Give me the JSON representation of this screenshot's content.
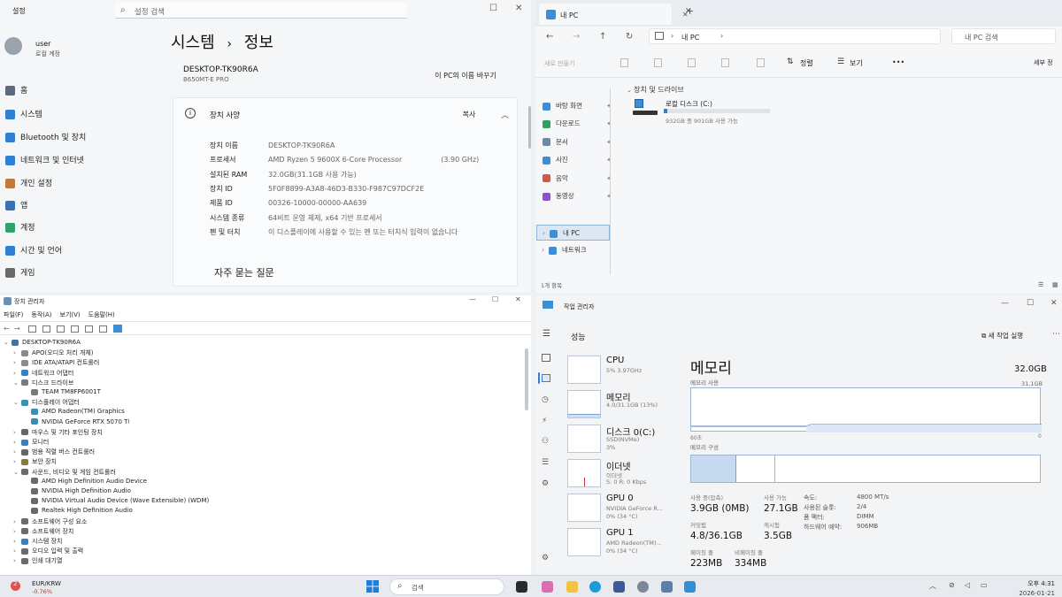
{
  "settings": {
    "app_title": "설정",
    "search_placeholder": "설정 검색",
    "user_name": "user",
    "user_sub": "로컬 계정",
    "breadcrumb_parent": "시스템",
    "breadcrumb_sep": "›",
    "breadcrumb_current": "정보",
    "device_name": "DESKTOP-TK90R6A",
    "device_model": "B650MT-E PRO",
    "rename_button": "이 PC의 이름 바꾸기",
    "specs_header": "장치 사양",
    "copy_button": "복사",
    "faq_label": "자주 묻는 질문",
    "nav": [
      {
        "label": "홈",
        "icon": "home-icon",
        "color": "#5a6b80"
      },
      {
        "label": "시스템",
        "icon": "monitor-icon",
        "color": "#2f7fd3"
      },
      {
        "label": "Bluetooth 및 장치",
        "icon": "bluetooth-icon",
        "color": "#2f7fd3"
      },
      {
        "label": "네트워크 및 인터넷",
        "icon": "wifi-icon",
        "color": "#2f7fd3"
      },
      {
        "label": "개인 설정",
        "icon": "brush-icon",
        "color": "#c07a3a"
      },
      {
        "label": "앱",
        "icon": "apps-icon",
        "color": "#3b6fb6"
      },
      {
        "label": "계정",
        "icon": "account-icon",
        "color": "#2fa36b"
      },
      {
        "label": "시간 및 언어",
        "icon": "globe-icon",
        "color": "#2f7fd3"
      },
      {
        "label": "게임",
        "icon": "gamepad-icon",
        "color": "#6a6a6a"
      }
    ],
    "specs": [
      {
        "key": "장치 이름",
        "value": "DESKTOP-TK90R6A"
      },
      {
        "key": "프로세서",
        "value": "AMD Ryzen 5 9600X 6-Core Processor",
        "extra": "(3.90 GHz)"
      },
      {
        "key": "설치된 RAM",
        "value": "32.0GB(31.1GB 사용 가능)"
      },
      {
        "key": "장치 ID",
        "value": "5F0F8899-A3A8-46D3-B330-F987C97DCF2E"
      },
      {
        "key": "제품 ID",
        "value": "00326-10000-00000-AA639"
      },
      {
        "key": "시스템 종류",
        "value": "64비트 운영 체제, x64 기반 프로세서"
      },
      {
        "key": "펜 및 터치",
        "value": "이 디스플레이에 사용할 수 있는 펜 또는 터치식 입력이 없습니다"
      }
    ]
  },
  "explorer": {
    "tab_title": "내 PC",
    "add_tab": "+",
    "address_sep": "›",
    "address_text": "내 PC",
    "search_placeholder": "내 PC 검색",
    "sort_label": "정렬",
    "view_label": "보기",
    "more_label": "•••",
    "details_label": "세부 정",
    "new_label": "새로 만들기",
    "section_label": "장치 및 드라이브",
    "drive_name": "로컬 디스크 (C:)",
    "drive_usage": "932GB 중 901GB 사용 가능",
    "drive_used_fraction": 0.03,
    "status_text": "1개 항목",
    "quick_access": [
      {
        "label": "바탕 화면",
        "icon": "desktop-icon",
        "color": "#3a8fd8"
      },
      {
        "label": "다운로드",
        "icon": "download-icon",
        "color": "#2f9e5f"
      },
      {
        "label": "문서",
        "icon": "document-icon",
        "color": "#6f87a8"
      },
      {
        "label": "사진",
        "icon": "pictures-icon",
        "color": "#3a8fd8"
      },
      {
        "label": "음악",
        "icon": "music-icon",
        "color": "#d9534f"
      },
      {
        "label": "동영상",
        "icon": "video-icon",
        "color": "#8a55c9"
      }
    ],
    "tree": [
      {
        "label": "내 PC",
        "icon": "pc-icon",
        "color": "#3a8fd8",
        "selected": true
      },
      {
        "label": "네트워크",
        "icon": "network-icon",
        "color": "#3a8fd8",
        "selected": false
      }
    ]
  },
  "device_manager": {
    "title": "장치 관리자",
    "menu": [
      "파일(F)",
      "동작(A)",
      "보기(V)",
      "도움말(H)"
    ],
    "rows": [
      {
        "label": "DESKTOP-TK90R6A",
        "level": 0,
        "expanded": true,
        "color": "#4a6e9e"
      },
      {
        "label": "APO(오디오 처리 개체)",
        "level": 1,
        "expanded": false,
        "color": "#8a8a8a"
      },
      {
        "label": "IDE ATA/ATAPI 컨트롤러",
        "level": 1,
        "expanded": false,
        "color": "#8a8a8a"
      },
      {
        "label": "네트워크 어댑터",
        "level": 1,
        "expanded": false,
        "color": "#3a7fc0"
      },
      {
        "label": "디스크 드라이브",
        "level": 1,
        "expanded": true,
        "color": "#7a7a7a"
      },
      {
        "label": "TEAM TM8FP6001T",
        "level": 2,
        "expanded": null,
        "color": "#7a7a7a"
      },
      {
        "label": "디스플레이 어댑터",
        "level": 1,
        "expanded": true,
        "color": "#3a8fb0"
      },
      {
        "label": "AMD Radeon(TM) Graphics",
        "level": 2,
        "expanded": null,
        "color": "#3a8fb0"
      },
      {
        "label": "NVIDIA GeForce RTX 5070 Ti",
        "level": 2,
        "expanded": null,
        "color": "#3a8fb0"
      },
      {
        "label": "마우스 및 기타 포인팅 장치",
        "level": 1,
        "expanded": false,
        "color": "#666"
      },
      {
        "label": "모니터",
        "level": 1,
        "expanded": false,
        "color": "#3a7fc0"
      },
      {
        "label": "범용 직렬 버스 컨트롤러",
        "level": 1,
        "expanded": false,
        "color": "#666"
      },
      {
        "label": "보안 장치",
        "level": 1,
        "expanded": false,
        "color": "#8a7a3a"
      },
      {
        "label": "사운드, 비디오 및 게임 컨트롤러",
        "level": 1,
        "expanded": true,
        "color": "#6a6a6a"
      },
      {
        "label": "AMD High Definition Audio Device",
        "level": 2,
        "expanded": null,
        "color": "#6a6a6a"
      },
      {
        "label": "NVIDIA High Definition Audio",
        "level": 2,
        "expanded": null,
        "color": "#6a6a6a"
      },
      {
        "label": "NVIDIA Virtual Audio Device (Wave Extensible) (WDM)",
        "level": 2,
        "expanded": null,
        "color": "#6a6a6a"
      },
      {
        "label": "Realtek High Definition Audio",
        "level": 2,
        "expanded": null,
        "color": "#6a6a6a"
      },
      {
        "label": "소프트웨어 구성 요소",
        "level": 1,
        "expanded": false,
        "color": "#6a6a6a"
      },
      {
        "label": "소프트웨어 장치",
        "level": 1,
        "expanded": false,
        "color": "#6a6a6a"
      },
      {
        "label": "시스템 장치",
        "level": 1,
        "expanded": false,
        "color": "#3a7fc0"
      },
      {
        "label": "오디오 입력 및 출력",
        "level": 1,
        "expanded": false,
        "color": "#6a6a6a"
      },
      {
        "label": "인쇄 대기열",
        "level": 1,
        "expanded": false,
        "color": "#6a6a6a"
      }
    ]
  },
  "task_manager": {
    "title": "작업 관리자",
    "page_title": "성능",
    "new_task": "새 작업 실행",
    "panel_title": "메모리",
    "panel_total": "32.0GB",
    "usage_label": "메모리 사용",
    "usage_max": "31.1GB",
    "time_label": "60초",
    "zero_label": "0",
    "composition_label": "메모리 구성",
    "items": [
      {
        "name": "CPU",
        "sub": "5% 3.97GHz",
        "sub2": ""
      },
      {
        "name": "메모리",
        "sub": "4.0/31.1GB (13%)",
        "sub2": ""
      },
      {
        "name": "디스크 0(C:)",
        "sub": "SSD(NVMe)",
        "sub2": "3%"
      },
      {
        "name": "이더넷",
        "sub": "이더넷",
        "sub2": "S: 0 R: 0 Kbps"
      },
      {
        "name": "GPU 0",
        "sub": "NVIDIA GeForce R...",
        "sub2": "0% (34 °C)"
      },
      {
        "name": "GPU 1",
        "sub": "AMD Radeon(TM)...",
        "sub2": "0% (34 °C)"
      }
    ],
    "stats": {
      "in_use_label": "사용 중(압축)",
      "in_use": "3.9GB (0MB)",
      "available_label": "사용 가능",
      "available": "27.1GB",
      "committed_label": "커밋됨",
      "committed": "4.8/36.1GB",
      "cached_label": "캐시됨",
      "cached": "3.5GB",
      "paged_label": "페이징 풀",
      "paged": "223MB",
      "nonpaged_label": "비페이징 풀",
      "nonpaged": "334MB",
      "speed_label": "속도:",
      "speed": "4800 MT/s",
      "slots_label": "사용된 슬롯:",
      "slots": "2/4",
      "form_label": "폼 팩터:",
      "form": "DIMM",
      "reserved_label": "하드웨어 예약:",
      "reserved": "906MB"
    }
  },
  "taskbar": {
    "weather_title": "EUR/KRW",
    "weather_sub": "-0.76%",
    "badge": "2",
    "search_placeholder": "검색",
    "time": "오후 4:31",
    "date": "2026-01-21"
  }
}
